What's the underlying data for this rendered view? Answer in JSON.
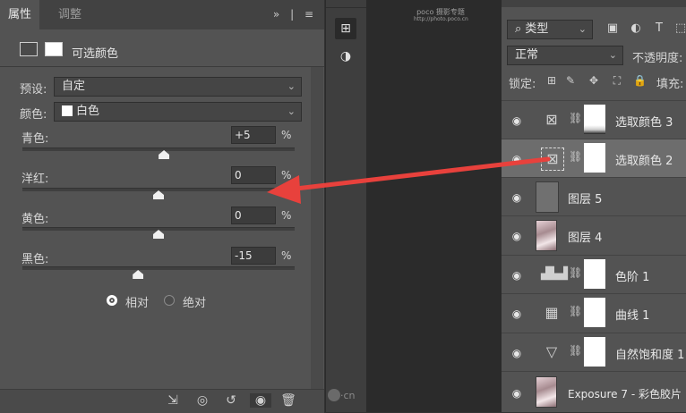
{
  "properties_panel": {
    "tabs": [
      "属性",
      "调整"
    ],
    "menu_glyph": "»",
    "title": "可选颜色",
    "preset_label": "预设:",
    "preset_value": "自定",
    "colors_label": "颜色:",
    "colors_value": "白色",
    "sliders": [
      {
        "label": "青色:",
        "value": "+5",
        "unit": "%",
        "position": 0.52
      },
      {
        "label": "洋红:",
        "value": "0",
        "unit": "%",
        "position": 0.5
      },
      {
        "label": "黄色:",
        "value": "0",
        "unit": "%",
        "position": 0.5
      },
      {
        "label": "黑色:",
        "value": "-15",
        "unit": "%",
        "position": 0.425
      }
    ],
    "method": {
      "relative": "相对",
      "absolute": "绝对",
      "selected": "relative"
    }
  },
  "watermark": {
    "brand": "poco 摄影专题",
    "url": "http://photo.poco.cn"
  },
  "uimaker_watermark": "·cn",
  "layers_panel": {
    "filter_label": "类型",
    "blend_mode": "正常",
    "opacity_label": "不透明度:",
    "lock_label": "锁定:",
    "fill_label": "填充:",
    "layers": [
      {
        "name": "选取颜色 3",
        "kind": "selective-color",
        "has_mask": true,
        "selected": false
      },
      {
        "name": "选取颜色 2",
        "kind": "selective-color",
        "has_mask": true,
        "selected": true
      },
      {
        "name": "图层 5",
        "kind": "gray-fill",
        "has_mask": false,
        "selected": false
      },
      {
        "name": "图层 4",
        "kind": "photo",
        "has_mask": false,
        "selected": false
      },
      {
        "name": "色阶 1",
        "kind": "levels",
        "has_mask": true,
        "selected": false
      },
      {
        "name": "曲线 1",
        "kind": "curves",
        "has_mask": true,
        "selected": false
      },
      {
        "name": "自然饱和度 1",
        "kind": "vibrance",
        "has_mask": true,
        "selected": false
      },
      {
        "name": "Exposure 7 - 彩色胶片",
        "kind": "photo",
        "has_mask": false,
        "selected": false
      }
    ]
  },
  "annotation": {
    "color": "#e8413c"
  }
}
